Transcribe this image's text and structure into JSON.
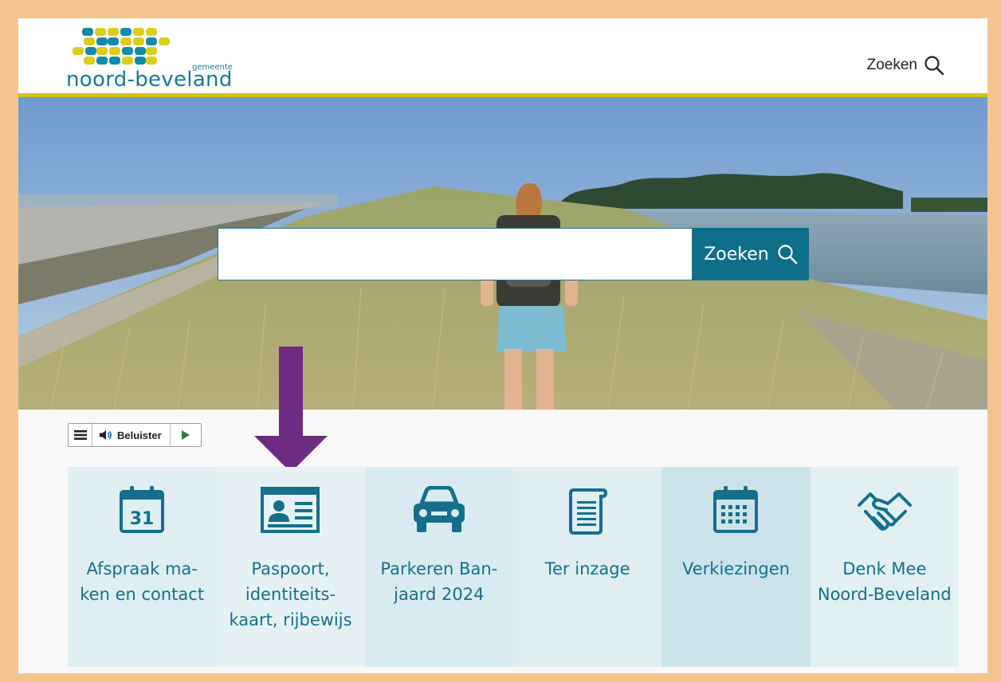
{
  "header": {
    "logo": {
      "word": "noord-beveland",
      "small": "gemeente"
    },
    "search_label": "Zoeken"
  },
  "hero": {
    "search_placeholder": "",
    "search_button_label": "Zoeken"
  },
  "readspeaker": {
    "listen_label": "Beluister"
  },
  "tiles": [
    {
      "label": "Afspraak ma-ken en contact",
      "icon": "calendar-31-icon",
      "day": "31",
      "bg": "#dfeef2"
    },
    {
      "label": "Paspoort, identiteits-kaart, rijbewijs",
      "icon": "id-card-icon",
      "bg": "#e5f1f4"
    },
    {
      "label": "Parkeren Ban-jaard 2024",
      "icon": "car-icon",
      "bg": "#d9ebf0"
    },
    {
      "label": "Ter inzage",
      "icon": "document-scroll-icon",
      "bg": "#e0eef2"
    },
    {
      "label": "Verkiezingen",
      "icon": "calendar-grid-icon",
      "bg": "#cbe2e9"
    },
    {
      "label": "Denk Mee Noord-Beveland",
      "icon": "handshake-icon",
      "bg": "#e2f0f3"
    }
  ],
  "colors": {
    "brand_teal": "#0f6f8a",
    "brand_yellow": "#d2c21c",
    "frame_border": "#f5c48e",
    "annotation_arrow": "#6f2a82"
  }
}
